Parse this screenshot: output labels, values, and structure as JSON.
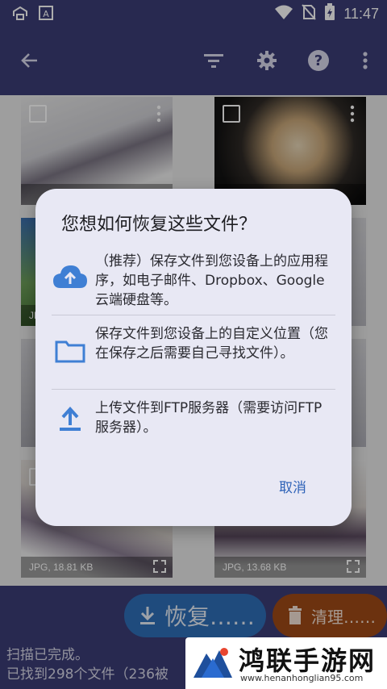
{
  "status_bar": {
    "time": "11:47",
    "icons": [
      "cloud-sync-icon",
      "font-app-icon",
      "wifi-icon",
      "no-sim-icon",
      "battery-charging-icon"
    ]
  },
  "app_bar": {
    "icons": [
      "back-arrow-icon",
      "filter-icon",
      "settings-gear-icon",
      "help-icon",
      "overflow-menu-icon"
    ]
  },
  "grid": {
    "tiles": [
      {
        "type": "",
        "size": ""
      },
      {
        "type": "",
        "size": ""
      },
      {
        "type": "JPG",
        "size": ""
      },
      {
        "type": "",
        "size": ""
      },
      {
        "type": "",
        "size": ""
      },
      {
        "type": "",
        "size": ""
      },
      {
        "type": "",
        "size": ""
      },
      {
        "type": "",
        "size": ""
      },
      {
        "type": "JPG, 18.81 KB",
        "size": ""
      },
      {
        "type": "JPG, 13.68 KB",
        "size": ""
      }
    ]
  },
  "dialog": {
    "title": "您想如何恢复这些文件？",
    "options": [
      {
        "icon": "cloud-upload-icon",
        "text": "（推荐）保存文件到您设备上的应用程序，如电子邮件、Dropbox、Google云端硬盘等。"
      },
      {
        "icon": "folder-icon",
        "text": "保存文件到您设备上的自定义位置（您在保存之后需要自己寻找文件）。"
      },
      {
        "icon": "upload-icon",
        "text": "上传文件到FTP服务器（需要访问FTP服务器）。"
      }
    ],
    "cancel_label": "取消",
    "colors": {
      "accent": "#2f63b8",
      "icon": "#3f7fd4"
    }
  },
  "bottom_bar": {
    "recover_label": "恢复……",
    "clean_label": "清理……",
    "status_line1": "扫描已完成。",
    "status_line2": "已找到298个文件（236被"
  },
  "watermark": {
    "title": "鸿联手游网",
    "url": "www.henanhonglian95.com"
  }
}
